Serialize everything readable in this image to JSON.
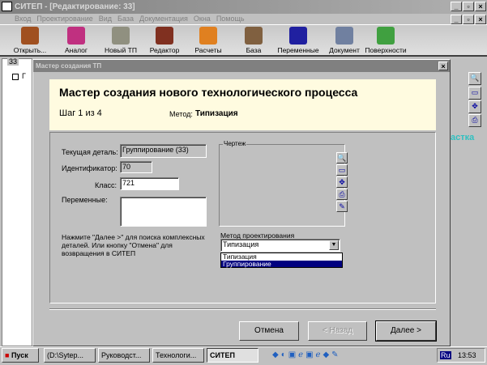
{
  "app": {
    "title": "СИТЕП - [Редактирование: 33]"
  },
  "menu": [
    "Вход",
    "Проектирование",
    "Вид",
    "База",
    "Документация",
    "Окна",
    "Помощь"
  ],
  "toolbar": [
    "Открыть...",
    "Аналог",
    "Новый ТП",
    "Редактор",
    "Расчеты",
    "База",
    "Переменные",
    "Документ",
    "Поверхности"
  ],
  "toolbar_colors": [
    "#a05020",
    "#c03080",
    "#909080",
    "#803020",
    "#e08020",
    "#806040",
    "#2020a0",
    "#7080a0",
    "#40a040"
  ],
  "left_panel": {
    "tab": "33",
    "tree_item": "Г"
  },
  "right_panel": {
    "label": "астка"
  },
  "dialog": {
    "title": "Мастер создания ТП",
    "heading": "Мастер создания нового технологического процесса",
    "step": "Шаг 1 из 4",
    "method_label": "Метод:",
    "method_value": "Типизация",
    "fields": {
      "current_part_label": "Текущая деталь:",
      "current_part": "Группирование (33)",
      "id_label": "Идентификатор:",
      "id": "70",
      "class_label": "Класс:",
      "class": "721",
      "vars_label": "Переменные:",
      "vars": ""
    },
    "hint": "Нажмите \"Далее >\" для поиска комплексных деталей. Или кнопку \"Отмена\" для возвращения в СИТЕП",
    "drawing_label": "Чертеж",
    "design_method_label": "Метод проектирования",
    "design_method_selected": "Типизация",
    "design_method_options": [
      "Типизация",
      "Группирование"
    ],
    "buttons": {
      "cancel": "Отмена",
      "back": "< Назад",
      "next": "Далее >"
    }
  },
  "taskbar": {
    "start": "Пуск",
    "tasks": [
      "(D:\\Sytep...",
      "Руководст...",
      "Технологи...",
      "СИТЕП"
    ],
    "lang": "Ru",
    "clock": "13:53"
  }
}
